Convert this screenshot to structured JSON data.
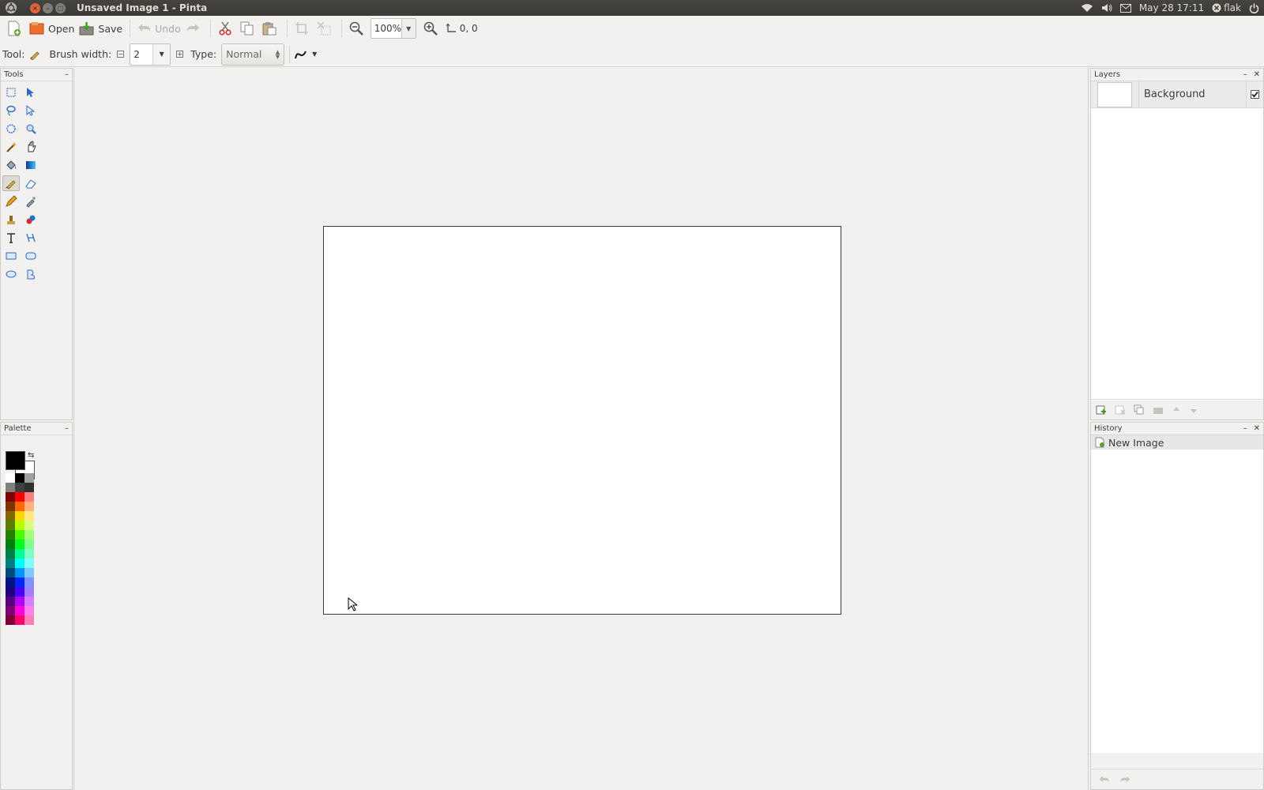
{
  "window": {
    "title": "Unsaved Image 1 - Pinta"
  },
  "system_tray": {
    "datetime": "May 28 17:11",
    "user": "flak",
    "icons": [
      "wifi-icon",
      "volume-icon",
      "mail-icon",
      "user-icon",
      "power-icon"
    ]
  },
  "toolbar": {
    "open_label": "Open",
    "save_label": "Save",
    "undo_label": "Undo",
    "zoom_value": "100%",
    "cursor_position": "0, 0"
  },
  "tool_options": {
    "tool_label": "Tool:",
    "brush_width_label": "Brush width:",
    "brush_width_value": "2",
    "type_label": "Type:",
    "type_value": "Normal"
  },
  "panels": {
    "tools_title": "Tools",
    "palette_title": "Palette",
    "layers_title": "Layers",
    "history_title": "History"
  },
  "tools": [
    {
      "name": "rectangle-select-icon"
    },
    {
      "name": "move-selected-icon"
    },
    {
      "name": "lasso-select-icon"
    },
    {
      "name": "move-selection-icon"
    },
    {
      "name": "ellipse-select-icon"
    },
    {
      "name": "zoom-icon"
    },
    {
      "name": "magic-wand-icon"
    },
    {
      "name": "pan-icon"
    },
    {
      "name": "paint-bucket-icon"
    },
    {
      "name": "gradient-icon"
    },
    {
      "name": "paintbrush-icon",
      "active": true
    },
    {
      "name": "eraser-icon"
    },
    {
      "name": "pencil-icon"
    },
    {
      "name": "color-picker-icon"
    },
    {
      "name": "clone-stamp-icon"
    },
    {
      "name": "recolor-icon"
    },
    {
      "name": "text-icon"
    },
    {
      "name": "line-curve-icon"
    },
    {
      "name": "rectangle-icon"
    },
    {
      "name": "rounded-rectangle-icon"
    },
    {
      "name": "ellipse-icon"
    },
    {
      "name": "freeform-shape-icon"
    }
  ],
  "palette": {
    "primary": "#000000",
    "secondary": "#ffffff",
    "colors": [
      [
        "#ffffff",
        "#000000",
        "#a0a0a0"
      ],
      [
        "#808080",
        "#404040",
        "#303030"
      ],
      [
        "#7f0000",
        "#ff0000",
        "#ff7f7f"
      ],
      [
        "#7f3300",
        "#ff6a00",
        "#ffb27f"
      ],
      [
        "#7f6a00",
        "#ffd800",
        "#ffe97f"
      ],
      [
        "#5b7f00",
        "#b6ff00",
        "#daff7f"
      ],
      [
        "#267f00",
        "#4cff00",
        "#a5ff7f"
      ],
      [
        "#007f0e",
        "#00ff21",
        "#7fff8e"
      ],
      [
        "#007f46",
        "#00ff90",
        "#7fffc5"
      ],
      [
        "#007f7f",
        "#00ffff",
        "#7fffff"
      ],
      [
        "#004a7f",
        "#0094ff",
        "#7fc9ff"
      ],
      [
        "#00137f",
        "#0026ff",
        "#7f92ff"
      ],
      [
        "#21007f",
        "#4800ff",
        "#a17fff"
      ],
      [
        "#57007f",
        "#b200ff",
        "#d67fff"
      ],
      [
        "#7f006e",
        "#ff00dc",
        "#ff7fed"
      ],
      [
        "#7f0037",
        "#ff006e",
        "#ff7fb6"
      ]
    ]
  },
  "layers": [
    {
      "name": "Background",
      "visible": true
    }
  ],
  "history": [
    {
      "label": "New Image"
    }
  ]
}
